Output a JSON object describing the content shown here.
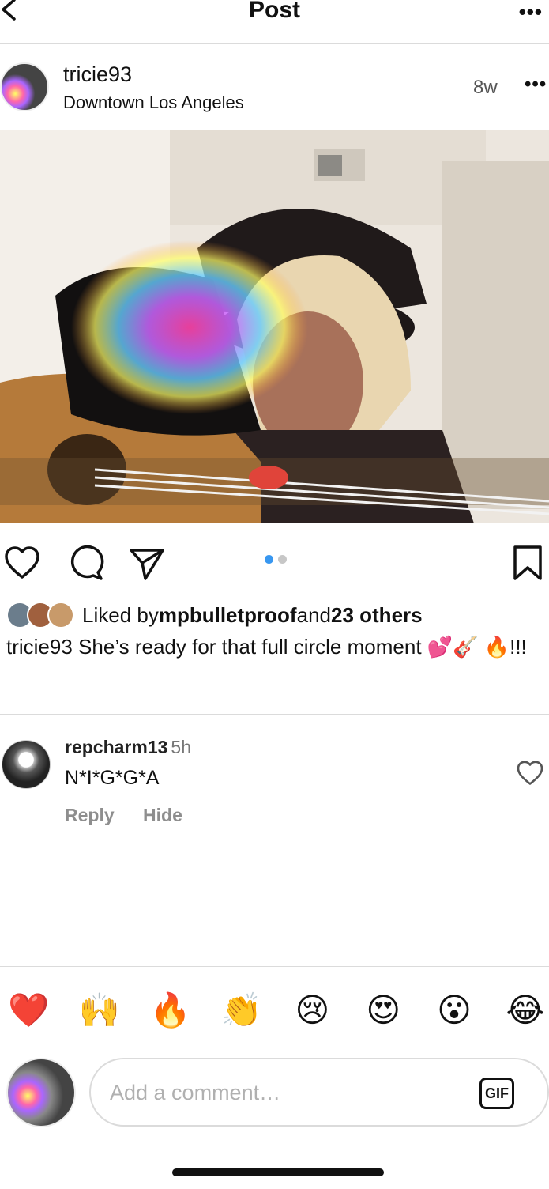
{
  "header": {
    "title": "Post",
    "back_icon": "chevron-left-icon",
    "more_icon": "ellipsis-icon"
  },
  "post": {
    "username": "tricie93",
    "location": "Downtown Los Angeles",
    "age": "8w",
    "photo_count": 2,
    "active_photo_index": 0
  },
  "likes": {
    "prefix": "Liked by ",
    "user": "mpbulletproof",
    "middle": " and ",
    "others": "23 others"
  },
  "caption": {
    "username": "tricie93",
    "text": " She’s ready for that full circle moment 💕🎸 🔥!!!"
  },
  "comment": {
    "username": "repcharm13",
    "time": "5h",
    "text": "N*I*G*G*A",
    "reply_label": "Reply",
    "hide_label": "Hide"
  },
  "quick_reactions": [
    "❤️",
    "🙌",
    "🔥",
    "👏",
    "😢",
    "😍",
    "😮",
    "😂"
  ],
  "composer": {
    "placeholder": "Add a comment…",
    "gif_label": "GIF"
  },
  "colors": {
    "accent_blue": "#3897f0",
    "divider": "#dbdbdb",
    "muted_text": "#8e8e8e"
  }
}
